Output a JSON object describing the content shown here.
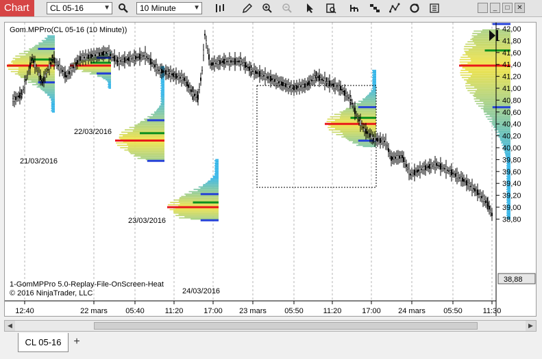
{
  "app": {
    "title": "Chart"
  },
  "toolbar": {
    "instrument": "CL 05-16",
    "interval": "10 Minute",
    "tools": [
      "search-icon",
      "bar-type-icon",
      "pencil-icon",
      "zoom-in-icon",
      "zoom-out-icon",
      "pointer-icon",
      "data-box-icon",
      "indicators-icon",
      "strategies-icon",
      "drawing-tools-icon",
      "reload-icon",
      "properties-icon"
    ]
  },
  "window_buttons": {
    "restore": "□",
    "minimize": "_",
    "maximize": "□",
    "close": "✕"
  },
  "chart": {
    "header": "Gom.MPPro(CL 05-16 (10 Minute))",
    "footer_line1": "1-GomMPPro 5.0-Replay-File-OnScreen-Heat",
    "footer_line2": "© 2016 NinjaTrader, LLC",
    "last_price": "38,88",
    "price_axis": [
      "42,00",
      "41,80",
      "41,60",
      "41,40",
      "41,20",
      "41,00",
      "40,80",
      "40,60",
      "40,40",
      "40,20",
      "40,00",
      "39,80",
      "39,60",
      "39,40",
      "39,20",
      "39,00",
      "38,80"
    ],
    "time_axis": [
      "12:40",
      "22 mars",
      "05:40",
      "11:20",
      "17:00",
      "23 mars",
      "05:50",
      "11:20",
      "17:00",
      "24 mars",
      "05:50",
      "11:30"
    ],
    "date_labels": [
      "21/03/2016",
      "22/03/2016",
      "23/03/2016",
      "24/03/2016"
    ],
    "colors": {
      "poc": "#e8171b",
      "value_high": "#2441d8",
      "value_mid": "#0b8f1f",
      "heat_hi": "#f4e44a",
      "heat_lo": "#37b6e8",
      "candle": "#000000"
    }
  },
  "tabs": [
    {
      "label": "CL 05-16"
    }
  ],
  "add_tab": "+"
}
